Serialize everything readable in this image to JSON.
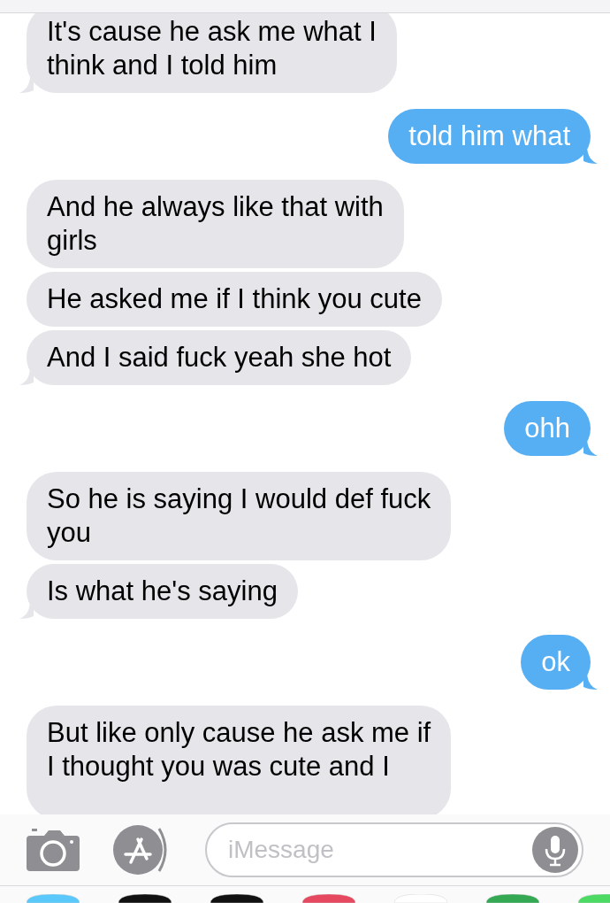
{
  "messages": [
    {
      "kind": "received",
      "text": "It's cause he ask me what I\nthink and I told him"
    },
    {
      "kind": "sent",
      "text": "told him what"
    },
    {
      "kind": "received",
      "text": "And he always like that with\ngirls"
    },
    {
      "kind": "received",
      "text": "He asked me if I think you cute"
    },
    {
      "kind": "received",
      "text": "And I said fuck yeah she hot"
    },
    {
      "kind": "sent",
      "text": "ohh"
    },
    {
      "kind": "received",
      "text": "So he is saying I would def fuck\nyou"
    },
    {
      "kind": "received",
      "text": "Is what he's saying"
    },
    {
      "kind": "sent",
      "text": "ok"
    },
    {
      "kind": "received",
      "text": "But like only cause he ask me if\nI thought you was cute and I"
    }
  ],
  "compose": {
    "placeholder": "iMessage"
  }
}
